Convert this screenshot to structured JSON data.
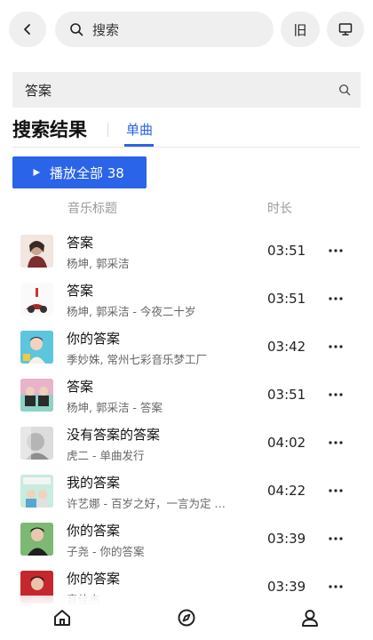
{
  "topbar": {
    "search_placeholder": "搜索",
    "old_label": "旧",
    "icons": [
      "chevron-left-icon",
      "search-icon",
      "monitor-icon"
    ]
  },
  "query": {
    "value": "答案"
  },
  "results": {
    "title": "搜索结果",
    "tab_single": "单曲"
  },
  "play_all": {
    "label": "播放全部 38"
  },
  "columns": {
    "title": "音乐标题",
    "duration": "时长"
  },
  "songs": [
    {
      "title": "答案",
      "subtitle": "杨坤, 郭采洁",
      "duration": "03:51"
    },
    {
      "title": "答案",
      "subtitle": "杨坤, 郭采洁 - 今夜二十岁",
      "duration": "03:51"
    },
    {
      "title": "你的答案",
      "subtitle": "季妙姝, 常州七彩音乐梦工厂",
      "duration": "03:42"
    },
    {
      "title": "答案",
      "subtitle": "杨坤, 郭采洁 - 答案",
      "duration": "03:51"
    },
    {
      "title": "没有答案的答案",
      "subtitle": "虎二 - 单曲发行",
      "duration": "04:02"
    },
    {
      "title": "我的答案",
      "subtitle": "许艺娜 - 百岁之好，一言为定 …",
      "duration": "04:22"
    },
    {
      "title": "你的答案",
      "subtitle": "子尧 - 你的答案",
      "duration": "03:39"
    },
    {
      "title": "你的答案",
      "subtitle": "音佳杰",
      "duration": "03:39"
    }
  ],
  "colors": {
    "accent": "#2a64e8",
    "pill_bg": "#efefef"
  },
  "bottom_nav_icons": [
    "home-icon",
    "compass-icon",
    "user-icon"
  ]
}
